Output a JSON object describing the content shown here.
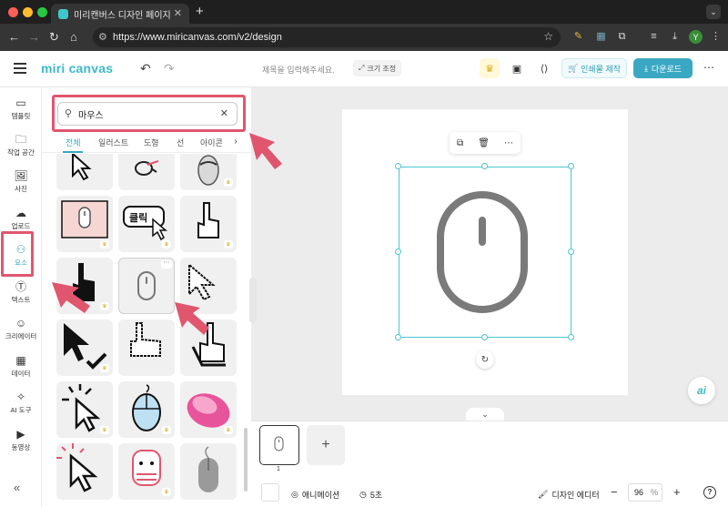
{
  "browser": {
    "tab_title": "미리캔버스 디자인 페이지",
    "url": "https://www.miricanvas.com/v2/design",
    "profile_initial": "Y"
  },
  "header": {
    "logo": "miri canvas",
    "doc_title_placeholder": "제목을 입력해주세요.",
    "resize_label": "크기 조정",
    "print_label": "인쇄물 제작",
    "download_label": "다운로드"
  },
  "rail": {
    "items": [
      {
        "label": "템플릿",
        "icon": "template-icon"
      },
      {
        "label": "작업 공간",
        "icon": "workspace-icon"
      },
      {
        "label": "사진",
        "icon": "photo-icon"
      },
      {
        "label": "업로드",
        "icon": "upload-icon"
      },
      {
        "label": "요소",
        "icon": "elements-icon"
      },
      {
        "label": "텍스트",
        "icon": "text-icon"
      },
      {
        "label": "크리에이터",
        "icon": "creator-icon"
      },
      {
        "label": "데이터",
        "icon": "data-icon"
      },
      {
        "label": "AI 도구",
        "icon": "ai-tools-icon"
      },
      {
        "label": "동영상",
        "icon": "video-icon"
      }
    ],
    "active": "요소"
  },
  "panel": {
    "search_value": "마우스",
    "categories": [
      "전체",
      "일러스트",
      "도형",
      "선",
      "아이콘"
    ],
    "active_category": "전체",
    "tiles": [
      {
        "name": "pixel-cursor-tile",
        "premium": false
      },
      {
        "name": "mouse-click-doodle-tile",
        "premium": false
      },
      {
        "name": "computer-mouse-photo-tile",
        "premium": true
      },
      {
        "name": "pink-mouse-frame-tile",
        "premium": true
      },
      {
        "name": "click-button-cursor-tile",
        "premium": true
      },
      {
        "name": "pointing-hand-tile",
        "premium": true
      },
      {
        "name": "black-hand-cursor-tile",
        "premium": true
      },
      {
        "name": "mouse-outline-tile",
        "premium": false
      },
      {
        "name": "pixel-arrow-cursor-tile",
        "premium": false
      },
      {
        "name": "arrow-check-tile",
        "premium": true
      },
      {
        "name": "pixel-hand-cursor-tile",
        "premium": false
      },
      {
        "name": "3d-hand-cursor-tile",
        "premium": false
      },
      {
        "name": "click-arrow-tile",
        "premium": true
      },
      {
        "name": "blue-mouse-tile",
        "premium": true
      },
      {
        "name": "pink-mouse-tile",
        "premium": true
      },
      {
        "name": "red-click-arrow-tile",
        "premium": false
      },
      {
        "name": "pink-mouse-character-tile",
        "premium": true
      },
      {
        "name": "grey-mouse-tile",
        "premium": false
      }
    ]
  },
  "canvas": {
    "page_number": "1",
    "selected_element": "mouse-outline"
  },
  "bottombar": {
    "animation_label": "애니메이션",
    "duration_label": "5초",
    "design_editor_label": "디자인 에디터",
    "zoom_value": "96",
    "zoom_unit": "%",
    "help_label": "?"
  },
  "colors": {
    "accent": "#39a8bf",
    "highlight": "#e0566f",
    "selection": "#4cc6d0"
  }
}
